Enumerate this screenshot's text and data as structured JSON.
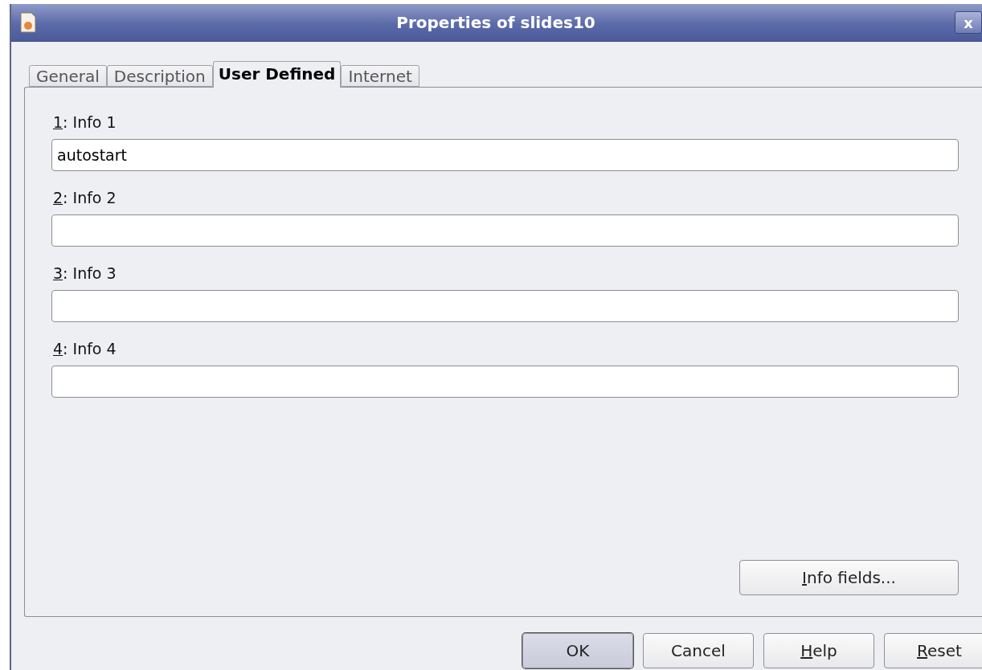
{
  "window": {
    "title": "Properties of slides10",
    "close": "x"
  },
  "tabs": [
    {
      "label": "General",
      "selected": false
    },
    {
      "label": "Description",
      "selected": false
    },
    {
      "label": "User Defined",
      "selected": true
    },
    {
      "label": "Internet",
      "selected": false
    }
  ],
  "fields": [
    {
      "label": "1: Info 1",
      "mnemonic": true,
      "value": "autostart"
    },
    {
      "label": "2: Info 2",
      "mnemonic": true
    },
    {
      "label": "3: Info 3",
      "mnemonic": true
    },
    {
      "label": "4: Info 4",
      "mnemonic": true
    }
  ],
  "info_fields_button": {
    "label": "Info fields...",
    "mnemonic": true
  },
  "buttons": [
    {
      "label": "OK",
      "mnemonic": false,
      "default": true
    },
    {
      "label": "Cancel",
      "mnemonic": false,
      "default": false
    },
    {
      "label": "Help",
      "mnemonic": true,
      "default": false
    },
    {
      "label": "Reset",
      "mnemonic": true,
      "default": false
    }
  ]
}
